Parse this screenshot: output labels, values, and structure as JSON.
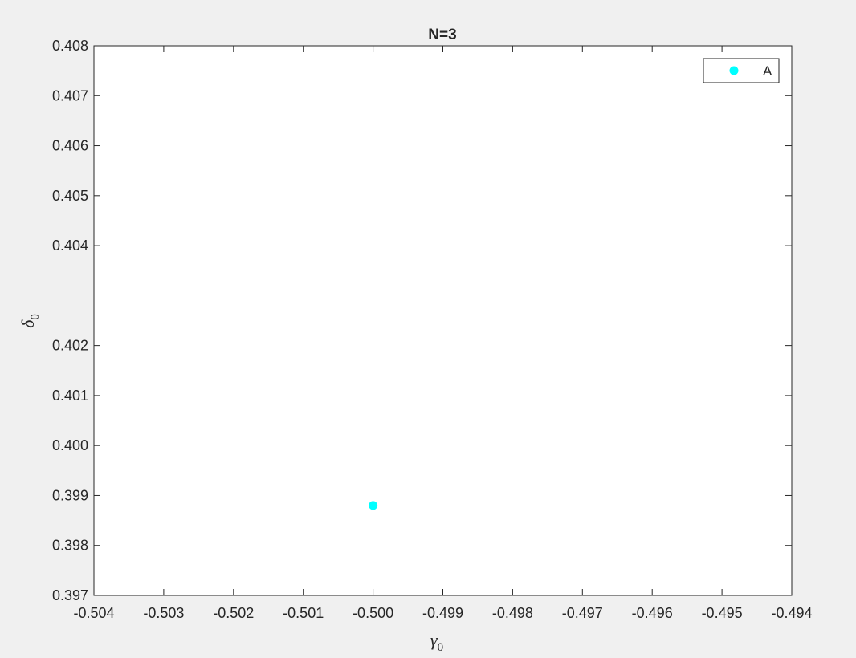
{
  "chart_data": {
    "type": "scatter",
    "title": "N=3",
    "xlabel_symbol": "γ",
    "xlabel_subscript": "0",
    "ylabel_symbol": "δ",
    "ylabel_subscript": "0",
    "xlim": [
      -0.504,
      -0.494
    ],
    "ylim": [
      0.397,
      0.408
    ],
    "xticks": [
      -0.504,
      -0.503,
      -0.502,
      -0.501,
      -0.5,
      -0.499,
      -0.498,
      -0.497,
      -0.496,
      -0.495,
      -0.494
    ],
    "xtick_labels": [
      "-0.504",
      "-0.503",
      "-0.502",
      "-0.501",
      "-0.500",
      "-0.499",
      "-0.498",
      "-0.497",
      "-0.496",
      "-0.495",
      "-0.494"
    ],
    "yticks": [
      0.397,
      0.398,
      0.399,
      0.4,
      0.401,
      0.402,
      0.404,
      0.405,
      0.406,
      0.407,
      0.408
    ],
    "ytick_labels": [
      "0.397",
      "0.398",
      "0.399",
      "0.400",
      "0.401",
      "0.402",
      "0.404",
      "0.405",
      "0.406",
      "0.407",
      "0.408"
    ],
    "grid": false,
    "legend_position": "top-right",
    "series": [
      {
        "name": "A",
        "color": "#00ffff",
        "marker": "circle",
        "points": [
          {
            "x": -0.5,
            "y": 0.3988
          }
        ]
      }
    ]
  }
}
